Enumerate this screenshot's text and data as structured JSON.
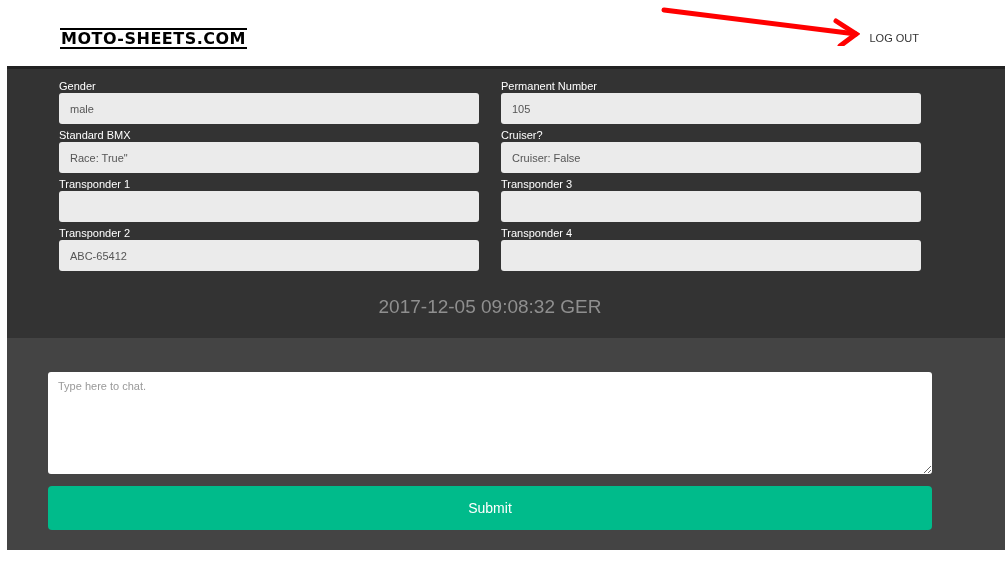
{
  "header": {
    "logo": "MOTO-SHEETS.COM",
    "logout": "LOG OUT"
  },
  "fields": [
    {
      "label": "Gender",
      "value": "male"
    },
    {
      "label": "Permanent Number",
      "value": "105"
    },
    {
      "label": "Standard BMX",
      "value": "Race: True\""
    },
    {
      "label": "Cruiser?",
      "value": "Cruiser: False"
    },
    {
      "label": "Transponder 1"
    },
    {
      "label": "Transponder 3"
    },
    {
      "label": "Transponder 2",
      "value": "ABC-65412"
    },
    {
      "label": "Transponder 4"
    }
  ],
  "timestamp": "2017-12-05 09:08:32 GER",
  "chat": {
    "placeholder": "Type here to chat."
  },
  "submit": "Submit"
}
